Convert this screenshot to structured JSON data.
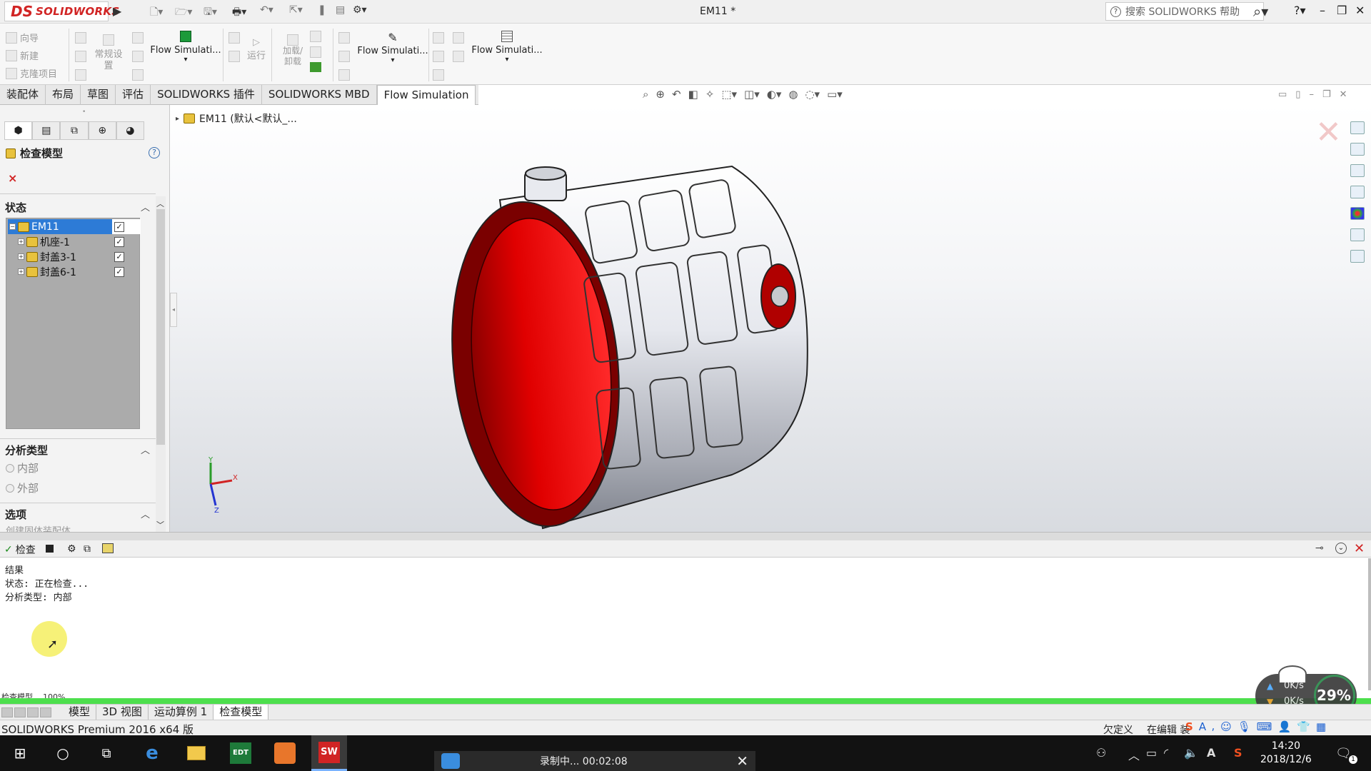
{
  "app": {
    "brand_short": "DS",
    "brand_name": "SOLIDWORKS",
    "doc_title": "EM11 *",
    "help_search_placeholder": "搜索 SOLIDWORKS 帮助"
  },
  "command_manager": {
    "left_group": [
      "向导",
      "新建",
      "克隆项目"
    ],
    "settings_small": "常规设置",
    "run_label": "运行",
    "load_unload_label": "加载/卸载",
    "flow_big_1": "Flow Simulati...",
    "flow_big_2": "Flow Simulati...",
    "flow_big_3": "Flow Simulati..."
  },
  "tabs": [
    "装配体",
    "布局",
    "草图",
    "评估",
    "SOLIDWORKS 插件",
    "SOLIDWORKS MBD",
    "Flow Simulation"
  ],
  "active_tab": "Flow Simulation",
  "left_panel": {
    "title": "检查模型",
    "help_glyph": "?",
    "close_glyph": "×",
    "status_header": "状态",
    "tree": [
      {
        "label": "EM11",
        "checked": true,
        "selected": true
      },
      {
        "label": "机座-1",
        "checked": true
      },
      {
        "label": "封盖3-1",
        "checked": true
      },
      {
        "label": "封盖6-1",
        "checked": true
      }
    ],
    "analysis_header": "分析类型",
    "analysis_options": [
      "内部",
      "外部"
    ],
    "options_header": "选项",
    "options_partial": "创建固体装配体"
  },
  "viewport": {
    "tree_root": "EM11  (默认<默认_..."
  },
  "output": {
    "tab_label": "检查",
    "lines": [
      "结果",
      "状态: 正在检查...",
      "分析类型: 内部"
    ],
    "progress_label": "检查模型... 100%",
    "progress_fraction": 1.0
  },
  "sheet_tabs": [
    "模型",
    "3D 视图",
    "运动算例 1",
    "检查模型"
  ],
  "active_sheet_tab": "检查模型",
  "status_bar": {
    "product": "SOLIDWORKS Premium 2016 x64 版",
    "underdefined": "欠定义",
    "editing": "在编辑 装"
  },
  "taskbar": {
    "recording": "录制中... 00:02:08",
    "time": "14:20",
    "date": "2018/12/6",
    "ime": "A"
  },
  "net_widget": {
    "up": "0K/s",
    "down": "0K/s",
    "percent": "29%"
  },
  "colors": {
    "accent_red": "#d12424",
    "selection_blue": "#2d7bd6",
    "progress_green": "#4ddf4d",
    "model_red": "#c00000"
  }
}
